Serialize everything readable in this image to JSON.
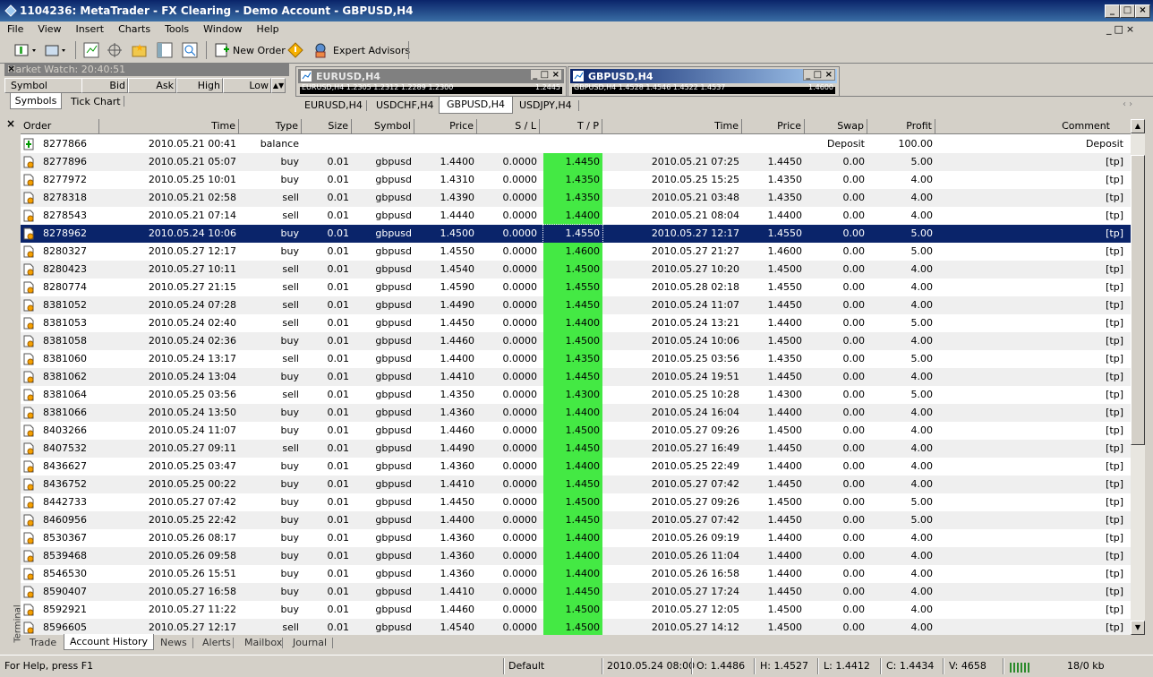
{
  "window": {
    "title": "1104236: MetaTrader - FX Clearing - Demo Account - GBPUSD,H4"
  },
  "menu": [
    "File",
    "View",
    "Insert",
    "Charts",
    "Tools",
    "Window",
    "Help"
  ],
  "toolbar": {
    "new_order": "New Order",
    "expert_advisors": "Expert Advisors"
  },
  "market_watch": {
    "title": "Market Watch: 20:40:51",
    "columns": [
      "Symbol",
      "Bid",
      "Ask",
      "High",
      "Low"
    ],
    "tabs": [
      "Symbols",
      "Tick Chart"
    ]
  },
  "chart_windows": [
    {
      "title": "EURUSD,H4",
      "info": "EURUSD,H4  1.2305 1.2312 1.2289 1.2300",
      "right_value": "1.2445"
    },
    {
      "title": "GBPUSD,H4",
      "info": "GBPUSD,H4  1.4528 1.4546 1.4522 1.4537",
      "right_value": "1.4600"
    }
  ],
  "chart_tabs": [
    "EURUSD,H4",
    "USDCHF,H4",
    "GBPUSD,H4",
    "USDJPY,H4"
  ],
  "chart_tabs_active": "GBPUSD,H4",
  "terminal": {
    "side_label": "Terminal",
    "columns": [
      "Order",
      "Time",
      "Type",
      "Size",
      "Symbol",
      "Price",
      "S / L",
      "T / P",
      "Time",
      "Price",
      "Swap",
      "Profit",
      "Comment"
    ],
    "rows": [
      {
        "order": "8277866",
        "time": "2010.05.21 00:41",
        "type": "balance",
        "size": "",
        "symbol": "",
        "price": "",
        "sl": "",
        "tp": "",
        "ctime": "",
        "cprice": "",
        "swap": "Deposit",
        "profit": "100.00",
        "comment": "Deposit",
        "kind": "balance"
      },
      {
        "order": "8277896",
        "time": "2010.05.21 05:07",
        "type": "buy",
        "size": "0.01",
        "symbol": "gbpusd",
        "price": "1.4400",
        "sl": "0.0000",
        "tp": "1.4450",
        "ctime": "2010.05.21 07:25",
        "cprice": "1.4450",
        "swap": "0.00",
        "profit": "5.00",
        "comment": "[tp]"
      },
      {
        "order": "8277972",
        "time": "2010.05.25 10:01",
        "type": "buy",
        "size": "0.01",
        "symbol": "gbpusd",
        "price": "1.4310",
        "sl": "0.0000",
        "tp": "1.4350",
        "ctime": "2010.05.25 15:25",
        "cprice": "1.4350",
        "swap": "0.00",
        "profit": "4.00",
        "comment": "[tp]"
      },
      {
        "order": "8278318",
        "time": "2010.05.21 02:58",
        "type": "sell",
        "size": "0.01",
        "symbol": "gbpusd",
        "price": "1.4390",
        "sl": "0.0000",
        "tp": "1.4350",
        "ctime": "2010.05.21 03:48",
        "cprice": "1.4350",
        "swap": "0.00",
        "profit": "4.00",
        "comment": "[tp]"
      },
      {
        "order": "8278543",
        "time": "2010.05.21 07:14",
        "type": "sell",
        "size": "0.01",
        "symbol": "gbpusd",
        "price": "1.4440",
        "sl": "0.0000",
        "tp": "1.4400",
        "ctime": "2010.05.21 08:04",
        "cprice": "1.4400",
        "swap": "0.00",
        "profit": "4.00",
        "comment": "[tp]"
      },
      {
        "order": "8278962",
        "time": "2010.05.24 10:06",
        "type": "buy",
        "size": "0.01",
        "symbol": "gbpusd",
        "price": "1.4500",
        "sl": "0.0000",
        "tp": "1.4550",
        "ctime": "2010.05.27 12:17",
        "cprice": "1.4550",
        "swap": "0.00",
        "profit": "5.00",
        "comment": "[tp]",
        "selected": true
      },
      {
        "order": "8280327",
        "time": "2010.05.27 12:17",
        "type": "buy",
        "size": "0.01",
        "symbol": "gbpusd",
        "price": "1.4550",
        "sl": "0.0000",
        "tp": "1.4600",
        "ctime": "2010.05.27 21:27",
        "cprice": "1.4600",
        "swap": "0.00",
        "profit": "5.00",
        "comment": "[tp]"
      },
      {
        "order": "8280423",
        "time": "2010.05.27 10:11",
        "type": "sell",
        "size": "0.01",
        "symbol": "gbpusd",
        "price": "1.4540",
        "sl": "0.0000",
        "tp": "1.4500",
        "ctime": "2010.05.27 10:20",
        "cprice": "1.4500",
        "swap": "0.00",
        "profit": "4.00",
        "comment": "[tp]"
      },
      {
        "order": "8280774",
        "time": "2010.05.27 21:15",
        "type": "sell",
        "size": "0.01",
        "symbol": "gbpusd",
        "price": "1.4590",
        "sl": "0.0000",
        "tp": "1.4550",
        "ctime": "2010.05.28 02:18",
        "cprice": "1.4550",
        "swap": "0.00",
        "profit": "4.00",
        "comment": "[tp]"
      },
      {
        "order": "8381052",
        "time": "2010.05.24 07:28",
        "type": "sell",
        "size": "0.01",
        "symbol": "gbpusd",
        "price": "1.4490",
        "sl": "0.0000",
        "tp": "1.4450",
        "ctime": "2010.05.24 11:07",
        "cprice": "1.4450",
        "swap": "0.00",
        "profit": "4.00",
        "comment": "[tp]"
      },
      {
        "order": "8381053",
        "time": "2010.05.24 02:40",
        "type": "sell",
        "size": "0.01",
        "symbol": "gbpusd",
        "price": "1.4450",
        "sl": "0.0000",
        "tp": "1.4400",
        "ctime": "2010.05.24 13:21",
        "cprice": "1.4400",
        "swap": "0.00",
        "profit": "5.00",
        "comment": "[tp]"
      },
      {
        "order": "8381058",
        "time": "2010.05.24 02:36",
        "type": "buy",
        "size": "0.01",
        "symbol": "gbpusd",
        "price": "1.4460",
        "sl": "0.0000",
        "tp": "1.4500",
        "ctime": "2010.05.24 10:06",
        "cprice": "1.4500",
        "swap": "0.00",
        "profit": "4.00",
        "comment": "[tp]"
      },
      {
        "order": "8381060",
        "time": "2010.05.24 13:17",
        "type": "sell",
        "size": "0.01",
        "symbol": "gbpusd",
        "price": "1.4400",
        "sl": "0.0000",
        "tp": "1.4350",
        "ctime": "2010.05.25 03:56",
        "cprice": "1.4350",
        "swap": "0.00",
        "profit": "5.00",
        "comment": "[tp]"
      },
      {
        "order": "8381062",
        "time": "2010.05.24 13:04",
        "type": "buy",
        "size": "0.01",
        "symbol": "gbpusd",
        "price": "1.4410",
        "sl": "0.0000",
        "tp": "1.4450",
        "ctime": "2010.05.24 19:51",
        "cprice": "1.4450",
        "swap": "0.00",
        "profit": "4.00",
        "comment": "[tp]"
      },
      {
        "order": "8381064",
        "time": "2010.05.25 03:56",
        "type": "sell",
        "size": "0.01",
        "symbol": "gbpusd",
        "price": "1.4350",
        "sl": "0.0000",
        "tp": "1.4300",
        "ctime": "2010.05.25 10:28",
        "cprice": "1.4300",
        "swap": "0.00",
        "profit": "5.00",
        "comment": "[tp]"
      },
      {
        "order": "8381066",
        "time": "2010.05.24 13:50",
        "type": "buy",
        "size": "0.01",
        "symbol": "gbpusd",
        "price": "1.4360",
        "sl": "0.0000",
        "tp": "1.4400",
        "ctime": "2010.05.24 16:04",
        "cprice": "1.4400",
        "swap": "0.00",
        "profit": "4.00",
        "comment": "[tp]"
      },
      {
        "order": "8403266",
        "time": "2010.05.24 11:07",
        "type": "buy",
        "size": "0.01",
        "symbol": "gbpusd",
        "price": "1.4460",
        "sl": "0.0000",
        "tp": "1.4500",
        "ctime": "2010.05.27 09:26",
        "cprice": "1.4500",
        "swap": "0.00",
        "profit": "4.00",
        "comment": "[tp]"
      },
      {
        "order": "8407532",
        "time": "2010.05.27 09:11",
        "type": "sell",
        "size": "0.01",
        "symbol": "gbpusd",
        "price": "1.4490",
        "sl": "0.0000",
        "tp": "1.4450",
        "ctime": "2010.05.27 16:49",
        "cprice": "1.4450",
        "swap": "0.00",
        "profit": "4.00",
        "comment": "[tp]"
      },
      {
        "order": "8436627",
        "time": "2010.05.25 03:47",
        "type": "buy",
        "size": "0.01",
        "symbol": "gbpusd",
        "price": "1.4360",
        "sl": "0.0000",
        "tp": "1.4400",
        "ctime": "2010.05.25 22:49",
        "cprice": "1.4400",
        "swap": "0.00",
        "profit": "4.00",
        "comment": "[tp]"
      },
      {
        "order": "8436752",
        "time": "2010.05.25 00:22",
        "type": "buy",
        "size": "0.01",
        "symbol": "gbpusd",
        "price": "1.4410",
        "sl": "0.0000",
        "tp": "1.4450",
        "ctime": "2010.05.27 07:42",
        "cprice": "1.4450",
        "swap": "0.00",
        "profit": "4.00",
        "comment": "[tp]"
      },
      {
        "order": "8442733",
        "time": "2010.05.27 07:42",
        "type": "buy",
        "size": "0.01",
        "symbol": "gbpusd",
        "price": "1.4450",
        "sl": "0.0000",
        "tp": "1.4500",
        "ctime": "2010.05.27 09:26",
        "cprice": "1.4500",
        "swap": "0.00",
        "profit": "5.00",
        "comment": "[tp]"
      },
      {
        "order": "8460956",
        "time": "2010.05.25 22:42",
        "type": "buy",
        "size": "0.01",
        "symbol": "gbpusd",
        "price": "1.4400",
        "sl": "0.0000",
        "tp": "1.4450",
        "ctime": "2010.05.27 07:42",
        "cprice": "1.4450",
        "swap": "0.00",
        "profit": "5.00",
        "comment": "[tp]"
      },
      {
        "order": "8530367",
        "time": "2010.05.26 08:17",
        "type": "buy",
        "size": "0.01",
        "symbol": "gbpusd",
        "price": "1.4360",
        "sl": "0.0000",
        "tp": "1.4400",
        "ctime": "2010.05.26 09:19",
        "cprice": "1.4400",
        "swap": "0.00",
        "profit": "4.00",
        "comment": "[tp]"
      },
      {
        "order": "8539468",
        "time": "2010.05.26 09:58",
        "type": "buy",
        "size": "0.01",
        "symbol": "gbpusd",
        "price": "1.4360",
        "sl": "0.0000",
        "tp": "1.4400",
        "ctime": "2010.05.26 11:04",
        "cprice": "1.4400",
        "swap": "0.00",
        "profit": "4.00",
        "comment": "[tp]"
      },
      {
        "order": "8546530",
        "time": "2010.05.26 15:51",
        "type": "buy",
        "size": "0.01",
        "symbol": "gbpusd",
        "price": "1.4360",
        "sl": "0.0000",
        "tp": "1.4400",
        "ctime": "2010.05.26 16:58",
        "cprice": "1.4400",
        "swap": "0.00",
        "profit": "4.00",
        "comment": "[tp]"
      },
      {
        "order": "8590407",
        "time": "2010.05.27 16:58",
        "type": "buy",
        "size": "0.01",
        "symbol": "gbpusd",
        "price": "1.4410",
        "sl": "0.0000",
        "tp": "1.4450",
        "ctime": "2010.05.27 17:24",
        "cprice": "1.4450",
        "swap": "0.00",
        "profit": "4.00",
        "comment": "[tp]"
      },
      {
        "order": "8592921",
        "time": "2010.05.27 11:22",
        "type": "buy",
        "size": "0.01",
        "symbol": "gbpusd",
        "price": "1.4460",
        "sl": "0.0000",
        "tp": "1.4500",
        "ctime": "2010.05.27 12:05",
        "cprice": "1.4500",
        "swap": "0.00",
        "profit": "4.00",
        "comment": "[tp]"
      },
      {
        "order": "8596605",
        "time": "2010.05.27 12:17",
        "type": "sell",
        "size": "0.01",
        "symbol": "gbpusd",
        "price": "1.4540",
        "sl": "0.0000",
        "tp": "1.4500",
        "ctime": "2010.05.27 14:12",
        "cprice": "1.4500",
        "swap": "0.00",
        "profit": "4.00",
        "comment": "[tp]"
      }
    ],
    "bottom_tabs": [
      "Trade",
      "Account History",
      "News",
      "Alerts",
      "Mailbox",
      "Journal"
    ],
    "bottom_tabs_active": "Account History"
  },
  "status": {
    "help": "For Help, press F1",
    "profile": "Default",
    "datetime": "2010.05.24 08:00",
    "open": "O: 1.4486",
    "high": "H: 1.4527",
    "low": "L: 1.4412",
    "close": "C: 1.4434",
    "volume": "V: 4658",
    "traffic": "18/0 kb"
  },
  "colors": {
    "selection": "#0a246a",
    "tp_fill": "#44e944",
    "titlebar": "#0a246a"
  }
}
